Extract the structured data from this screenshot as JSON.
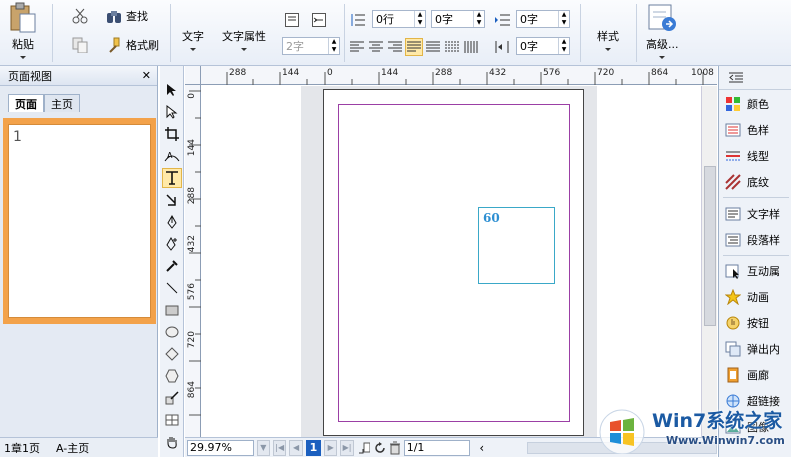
{
  "ribbon": {
    "paste": "粘贴",
    "find": "查找",
    "format_painter": "格式刷",
    "text": "文字",
    "text_properties": "文字属性",
    "font_size": "2字",
    "line_spacing": "0行",
    "char_spacing": "0字",
    "indent_left": "0字",
    "indent_first": "0字",
    "style": "样式",
    "advanced": "高级..."
  },
  "left_panel": {
    "title": "页面视图",
    "close": "✕",
    "tabs": [
      "页面",
      "主页"
    ],
    "thumb_label": "1",
    "status_chapter": "1章1页",
    "status_master": "A-主页"
  },
  "rulers": {
    "horizontal": [
      "288",
      "144",
      "0",
      "144",
      "288",
      "432",
      "576",
      "720",
      "864",
      "1008"
    ],
    "vertical": [
      "0",
      "144",
      "288",
      "432",
      "576",
      "720",
      "864"
    ]
  },
  "canvas": {
    "frame_text": "60"
  },
  "status": {
    "zoom": "29.97%",
    "current_page": "1",
    "page_count": "1/1"
  },
  "right_panel": {
    "items": [
      "颜色",
      "色样",
      "线型",
      "底纹",
      "文字样",
      "段落样",
      "互动属",
      "动画",
      "按钮",
      "弹出内",
      "画廊",
      "超链接",
      "图像"
    ]
  },
  "watermark": {
    "brand": "Win7系统之家",
    "url": "Www.Winwin7.com"
  },
  "colors": {
    "accent": "#f3a24a",
    "margin_guide": "#9b3fa5",
    "frame_border": "#3aa8c8"
  }
}
